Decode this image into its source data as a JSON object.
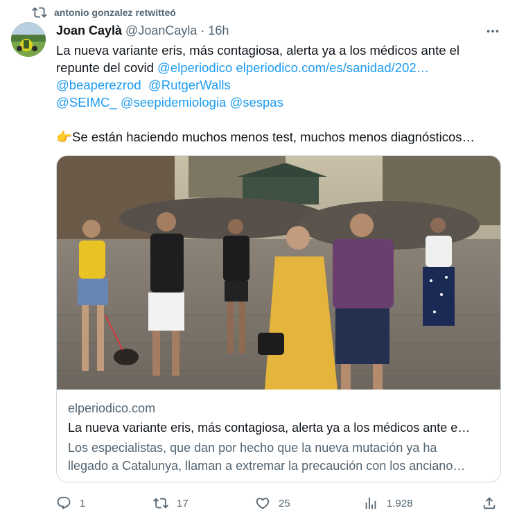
{
  "retweet": {
    "label": "antonio gonzalez retwitteó",
    "icon": "retweet-icon"
  },
  "author": {
    "name": "Joan Caylà",
    "handle": "@JoanCayla",
    "separator": "·",
    "time": "16h"
  },
  "tweet": {
    "line1": "La nueva variante eris, más contagiosa, alerta ya a los médicos ante el",
    "line2_text": "repunte del covid ",
    "mention_elperiodico": "@elperiodico",
    "url": "elperiodico.com/es/sanidad/202…",
    "mention_beaperezrod": "@beaperezrod",
    "mention_rutgerwalls": "@RutgerWalls",
    "mention_seimc": "@SEIMC_",
    "mention_seepidemiologia": "@seepidemiologia",
    "mention_sespas": "@sespas",
    "emoji": "👉",
    "line_last": "Se están haciendo muchos menos test, muchos menos diagnósticos…"
  },
  "card": {
    "domain": "elperiodico.com",
    "title": "La nueva variante eris, más contagiosa, alerta ya a los médicos ante e…",
    "description_line1": "Los especialistas, que dan por hecho que la nueva mutación ya ha",
    "description_line2": "llegado a Catalunya, llaman a extremar la precaución con los anciano…"
  },
  "actions": {
    "replies": "1",
    "retweets": "17",
    "likes": "25",
    "views": "1.928"
  },
  "colors": {
    "accent": "#1d9bf0",
    "muted": "#536471",
    "text": "#0f1419",
    "border": "#cfd9de"
  }
}
